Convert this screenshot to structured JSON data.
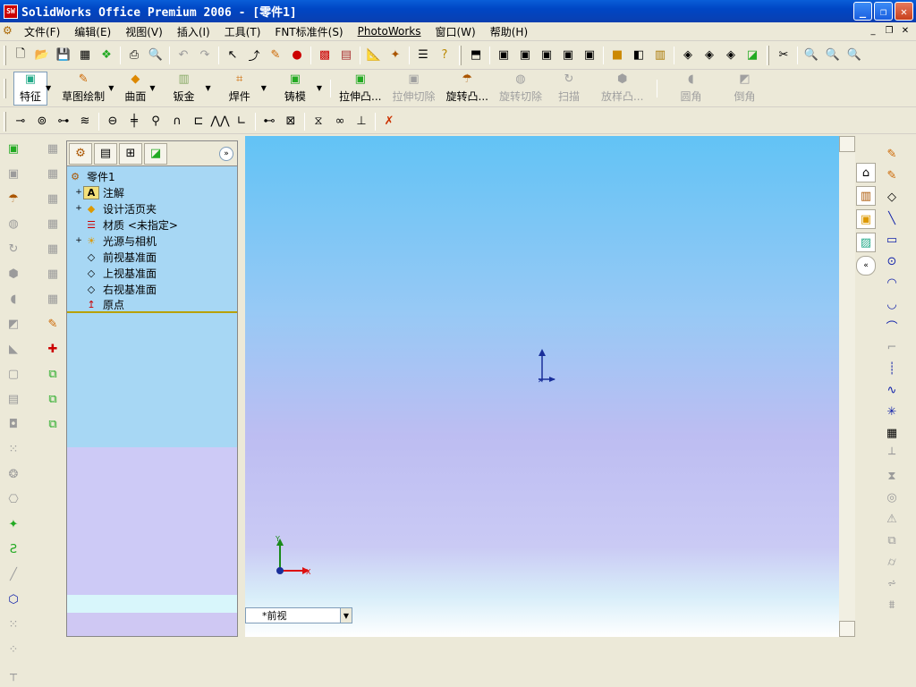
{
  "window": {
    "title": "SolidWorks Office Premium 2006 - [零件1]"
  },
  "menubar": [
    "文件(F)",
    "编辑(E)",
    "视图(V)",
    "插入(I)",
    "工具(T)",
    "FNT标准件(S)",
    "PhotoWorks",
    "窗口(W)",
    "帮助(H)"
  ],
  "command_manager": {
    "tabs": [
      {
        "label": "特征",
        "active": true
      },
      {
        "label": "草图绘制"
      },
      {
        "label": "曲面"
      },
      {
        "label": "钣金"
      },
      {
        "label": "焊件"
      },
      {
        "label": "铸模"
      }
    ],
    "features": [
      {
        "label": "拉伸凸...",
        "enabled": true
      },
      {
        "label": "拉伸切除",
        "enabled": false
      },
      {
        "label": "旋转凸...",
        "enabled": true
      },
      {
        "label": "旋转切除",
        "enabled": false
      },
      {
        "label": "扫描",
        "enabled": false
      },
      {
        "label": "放样凸...",
        "enabled": false
      },
      {
        "label": "圆角",
        "enabled": false
      },
      {
        "label": "倒角",
        "enabled": false
      }
    ]
  },
  "feature_manager": {
    "root": "零件1",
    "nodes": [
      {
        "label": "注解",
        "expandable": true,
        "icon": "annotation-icon"
      },
      {
        "label": "设计活页夹",
        "expandable": true,
        "icon": "binder-icon"
      },
      {
        "label": "材质 <未指定>",
        "expandable": false,
        "icon": "material-icon"
      },
      {
        "label": "光源与相机",
        "expandable": true,
        "icon": "lights-icon"
      },
      {
        "label": "前视基准面",
        "expandable": false,
        "icon": "plane-icon"
      },
      {
        "label": "上视基准面",
        "expandable": false,
        "icon": "plane-icon"
      },
      {
        "label": "右视基准面",
        "expandable": false,
        "icon": "plane-icon"
      },
      {
        "label": "原点",
        "expandable": false,
        "icon": "origin-icon"
      }
    ]
  },
  "viewport": {
    "view_name": "*前视",
    "triad": {
      "x": "X",
      "y": "Y"
    }
  },
  "colors": {
    "titlebar": "#0a5ed8",
    "fm_tree_bg": "#a7d7f4",
    "fm_lower_bg": "#cdcaf6",
    "viewport_top": "#62c3f5"
  }
}
